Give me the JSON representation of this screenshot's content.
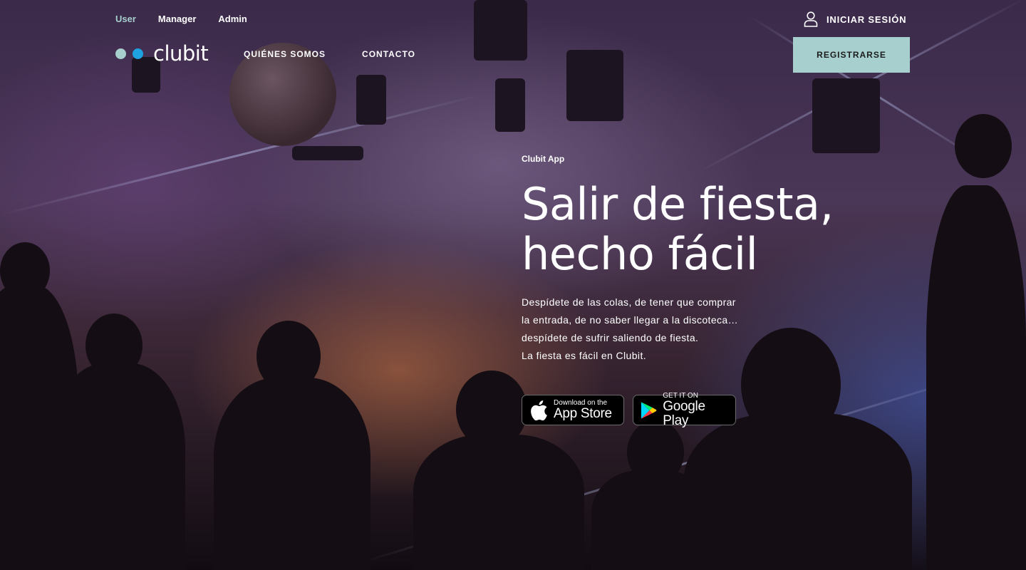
{
  "topnav": {
    "items": [
      "User",
      "Manager",
      "Admin"
    ]
  },
  "account": {
    "login_label": "INICIAR SESIÓN",
    "register_label": "REGISTRARSE",
    "icon": "user-icon"
  },
  "logo": {
    "text": "clubit"
  },
  "mainnav": {
    "items": [
      "QUIÉNES SOMOS",
      "CONTACTO"
    ]
  },
  "hero": {
    "eyebrow": "Clubit App",
    "headline_line1": "Salir de fiesta,",
    "headline_line2": "hecho fácil",
    "description": [
      "Despídete de las colas, de tener que comprar",
      "la entrada, de no saber llegar a la discoteca…",
      "despídete de sufrir saliendo de fiesta.",
      "La fiesta es fácil en Clubit."
    ]
  },
  "stores": {
    "apple_small": "Download on the",
    "apple_big": "App Store",
    "google_small": "GET IT ON",
    "google_big": "Google Play"
  },
  "colors": {
    "accent": "#a6cfcd",
    "logo_dot_blue": "#1fa2e0",
    "text": "#ffffff"
  }
}
